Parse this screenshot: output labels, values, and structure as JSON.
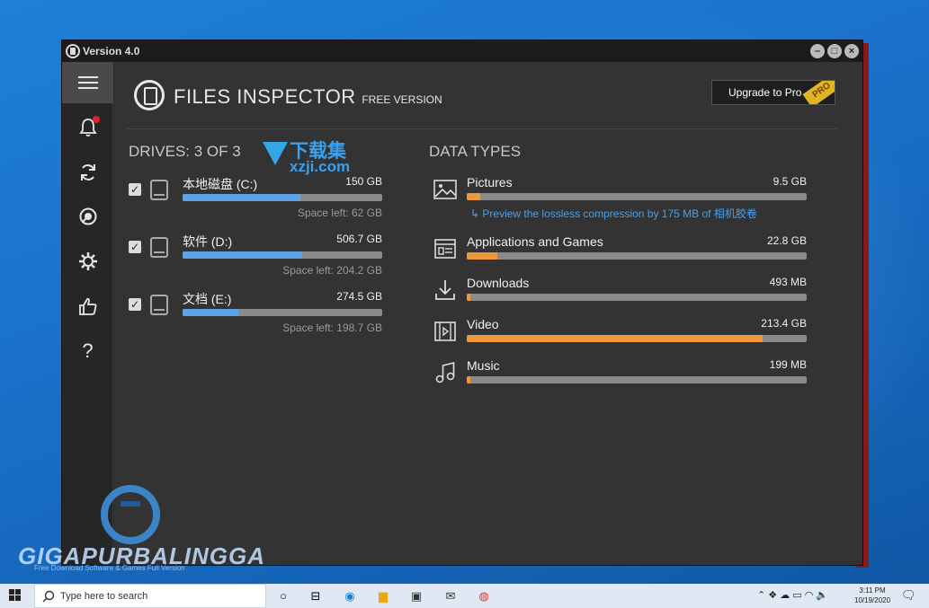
{
  "window": {
    "title": "Version 4.0",
    "controls": [
      "minimize",
      "maximize",
      "close"
    ]
  },
  "app": {
    "name": "FILES INSPECTOR",
    "edition": "FREE VERSION",
    "upgrade_label": "Upgrade to Pro",
    "pro_badge": "PRO"
  },
  "sidebar": {
    "items": [
      {
        "name": "menu-icon",
        "glyph": "≡"
      },
      {
        "name": "bell-icon",
        "glyph": "🔔"
      },
      {
        "name": "refresh-icon",
        "glyph": "↻"
      },
      {
        "name": "lifebuoy-icon",
        "glyph": "◐"
      },
      {
        "name": "gear-icon",
        "glyph": "⚙"
      },
      {
        "name": "thumbs-up-icon",
        "glyph": "👍"
      },
      {
        "name": "help-icon",
        "glyph": "?"
      }
    ]
  },
  "drives": {
    "title": "DRIVES: 3 OF 3",
    "items": [
      {
        "name": "本地磁盘 (C:)",
        "size": "150 GB",
        "free": "Space left: 62 GB",
        "used_fraction": 0.59,
        "checked": true
      },
      {
        "name": "软件 (D:)",
        "size": "506.7 GB",
        "free": "Space left: 204.2 GB",
        "used_fraction": 0.6,
        "checked": true
      },
      {
        "name": "文档 (E:)",
        "size": "274.5 GB",
        "free": "Space left: 198.7 GB",
        "used_fraction": 0.28,
        "checked": true
      }
    ]
  },
  "data_types": {
    "title": "DATA TYPES",
    "items": [
      {
        "name": "Pictures",
        "size": "9.5 GB",
        "fraction": 0.04,
        "icon": "image-icon"
      },
      {
        "name": "Applications and Games",
        "size": "22.8 GB",
        "fraction": 0.09,
        "icon": "applications-icon"
      },
      {
        "name": "Downloads",
        "size": "493 MB",
        "fraction": 0.01,
        "icon": "download-icon"
      },
      {
        "name": "Video",
        "size": "213.4 GB",
        "fraction": 0.87,
        "icon": "video-icon"
      },
      {
        "name": "Music",
        "size": "199 MB",
        "fraction": 0.01,
        "icon": "music-icon"
      }
    ],
    "preview_link": "Preview the lossless compression by 175 MB of 相机胶卷"
  },
  "watermarks": {
    "xzji_cn": "下载集",
    "xzji_en": "xzji.com",
    "giga": "GIGAPURBALINGGA",
    "giga_sub": "Free Download Software & Games Full Version"
  },
  "taskbar": {
    "search_placeholder": "Type here to search",
    "time": "3:11 PM",
    "date": "10/19/2020"
  },
  "colors": {
    "drive_bar": "#5ba3e8",
    "type_bar": "#f0963c",
    "link": "#4f9ee8",
    "notif_dot": "#e0202a",
    "pro_badge": "#e2b323"
  }
}
